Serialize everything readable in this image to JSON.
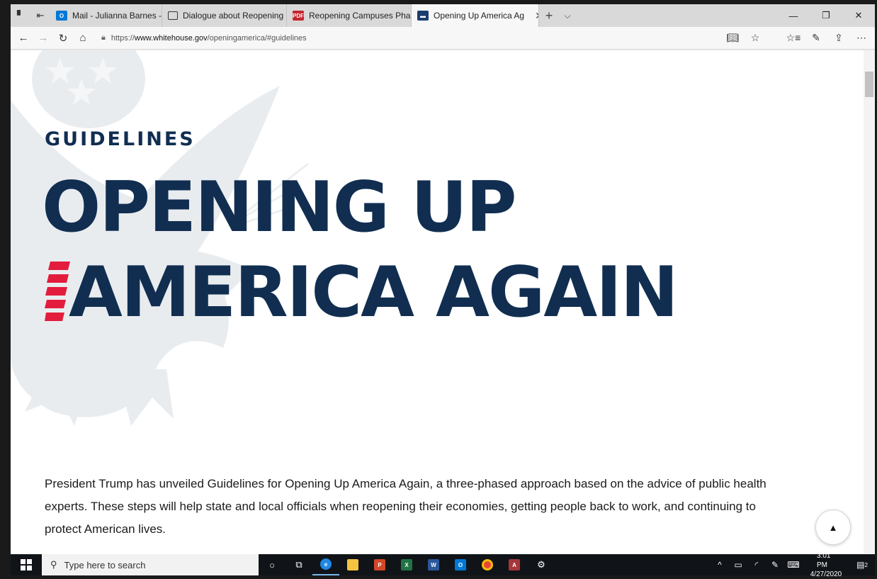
{
  "browser": {
    "tabs": [
      {
        "label": "Mail - Julianna Barnes - Out",
        "color": "#0078d4",
        "fav": "O"
      },
      {
        "label": "Dialogue about Reopening",
        "color": "",
        "fav": ""
      },
      {
        "label": "Reopening Campuses Phase",
        "color": "#c4262e",
        "fav": "PDF"
      },
      {
        "label": "Opening Up America Ag",
        "color": "#1a3d6d",
        "fav": "",
        "active": true
      }
    ],
    "url_prefix": "https://",
    "url_domain": "www.whitehouse.gov",
    "url_path": "/openingamerica/#guidelines"
  },
  "page": {
    "eyebrow": "GUIDELINES",
    "headline_line1": "OPENING UP",
    "headline_line2": "AMERICA AGAIN",
    "intro": "President Trump has unveiled Guidelines for Opening Up America Again, a three-phased approach based on the advice of public health experts. These steps will help state and local officials when reopening their economies, getting people back to work, and continuing to protect American lives.",
    "colors": {
      "navy": "#112e51",
      "red": "#e31c3d"
    }
  },
  "taskbar": {
    "search_placeholder": "Type here to search",
    "time": "3:01 PM",
    "date": "4/27/2020",
    "notification_count": "2"
  }
}
